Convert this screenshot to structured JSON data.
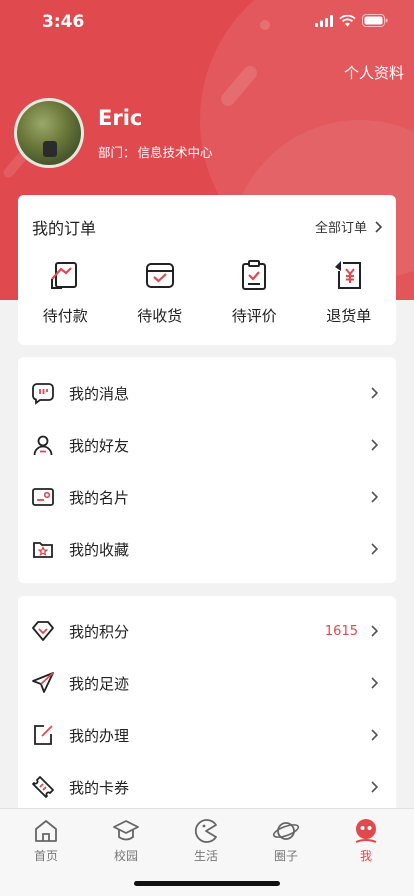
{
  "status_bar": {
    "time": "3:46"
  },
  "header": {
    "profile_link": "个人资料",
    "user_name": "Eric",
    "dept_label": "部门：",
    "dept_value": "信息技术中心"
  },
  "orders": {
    "title": "我的订单",
    "all_label": "全部订单",
    "items": [
      {
        "label": "待付款",
        "icon": "pending-payment-icon"
      },
      {
        "label": "待收货",
        "icon": "pending-receipt-icon"
      },
      {
        "label": "待评价",
        "icon": "pending-review-icon"
      },
      {
        "label": "退货单",
        "icon": "return-order-icon"
      }
    ]
  },
  "menu1": {
    "items": [
      {
        "label": "我的消息",
        "icon": "message-icon"
      },
      {
        "label": "我的好友",
        "icon": "friend-icon"
      },
      {
        "label": "我的名片",
        "icon": "business-card-icon"
      },
      {
        "label": "我的收藏",
        "icon": "favorites-icon"
      }
    ]
  },
  "menu2": {
    "items": [
      {
        "label": "我的积分",
        "icon": "points-diamond-icon",
        "value": "1615"
      },
      {
        "label": "我的足迹",
        "icon": "footprint-plane-icon"
      },
      {
        "label": "我的办理",
        "icon": "handling-edit-icon"
      },
      {
        "label": "我的卡券",
        "icon": "coupon-ticket-icon"
      }
    ]
  },
  "tabbar": {
    "tabs": [
      {
        "label": "首页",
        "icon": "home-icon"
      },
      {
        "label": "校园",
        "icon": "campus-cap-icon"
      },
      {
        "label": "生活",
        "icon": "life-pacman-icon"
      },
      {
        "label": "圈子",
        "icon": "circle-planet-icon"
      },
      {
        "label": "我",
        "icon": "me-face-icon",
        "active": true
      }
    ]
  },
  "colors": {
    "accent": "#e04a4f",
    "background": "#f2f2f2"
  }
}
